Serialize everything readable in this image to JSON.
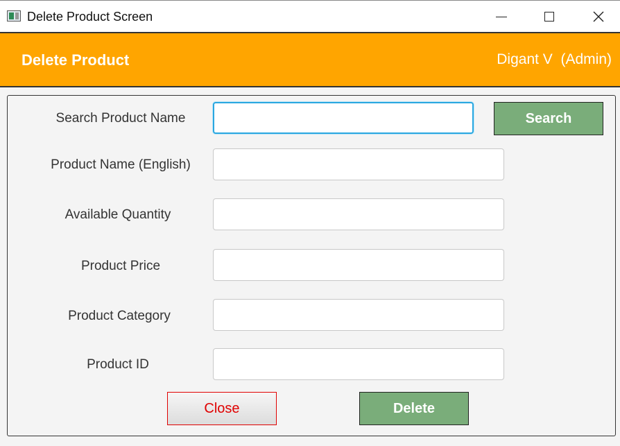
{
  "window": {
    "title": "Delete Product Screen",
    "minimize_symbol": "—",
    "maximize_symbol": "□",
    "close_symbol": "✕"
  },
  "header": {
    "title": "Delete Product",
    "user": "Digant V  (Admin)",
    "bg_color": "#ffa500"
  },
  "form": {
    "search_label": "Search Product Name",
    "search_value": "",
    "search_button": "Search",
    "fields": [
      {
        "label": "Product Name (English)",
        "value": ""
      },
      {
        "label": "Available Quantity",
        "value": ""
      },
      {
        "label": "Product Price",
        "value": ""
      },
      {
        "label": "Product Category",
        "value": ""
      },
      {
        "label": "Product ID",
        "value": ""
      }
    ]
  },
  "buttons": {
    "close": "Close",
    "delete": "Delete",
    "green_color": "#7aad7a",
    "close_color": "#e00000"
  }
}
